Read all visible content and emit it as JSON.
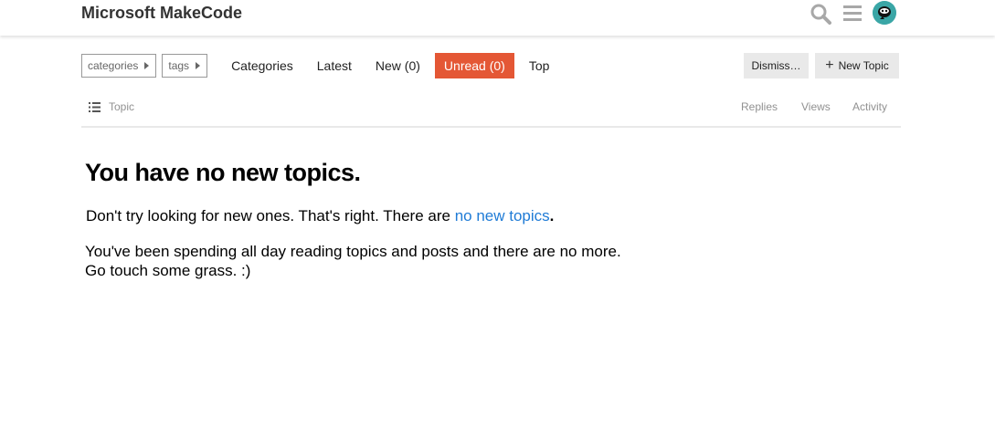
{
  "header": {
    "title": "Microsoft MakeCode",
    "icons": [
      "search-icon",
      "hamburger-menu-icon",
      "user-avatar"
    ]
  },
  "nav": {
    "categories_dropdown": "categories",
    "tags_dropdown": "tags",
    "links": [
      {
        "label": "Categories"
      },
      {
        "label": "Latest"
      },
      {
        "label": "New (0)"
      },
      {
        "label": "Unread (0)",
        "active": true
      },
      {
        "label": "Top"
      }
    ]
  },
  "actions": {
    "dismiss": "Dismiss…",
    "new_topic": "New Topic"
  },
  "list_header": {
    "topic": "Topic",
    "replies": "Replies",
    "views": "Views",
    "activity": "Activity"
  },
  "empty_state": {
    "title": "You have no new topics.",
    "line1_prefix": "Don't try looking for new ones. That's right. There are ",
    "line1_link": "no new topics",
    "line1_suffix": ".",
    "line2": "You've been spending all day reading topics and posts and there are no more.",
    "line3": "Go touch some grass. :)"
  },
  "colors": {
    "active_tab": "#e45735",
    "link": "#1f7bd6",
    "avatar": "#3aa6a6"
  }
}
